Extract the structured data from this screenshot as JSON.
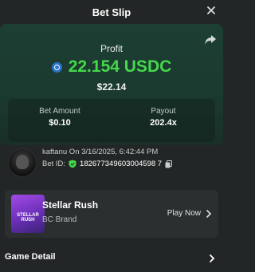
{
  "header": {
    "title": "Bet Slip",
    "close_icon": "close-icon"
  },
  "profit": {
    "label": "Profit",
    "currency_icon": "usdc-icon",
    "amount": "22.154 USDC",
    "usd_value": "$22.14",
    "accent_color": "#45d84a"
  },
  "stats": {
    "bet_amount_label": "Bet Amount",
    "bet_amount_value": "$0.10",
    "payout_label": "Payout",
    "payout_value": "202.4x"
  },
  "ticket": {
    "user_line": "kaftanu On 3/16/2025, 6:42:44 PM",
    "bet_id_label": "Bet ID:",
    "bet_id_value": "182677349603004598 7"
  },
  "game": {
    "thumb_text": "STELLAR RUSH",
    "name": "Stellar Rush",
    "brand": "BC Brand",
    "play_label": "Play Now"
  },
  "detail": {
    "label": "Game Detail"
  }
}
